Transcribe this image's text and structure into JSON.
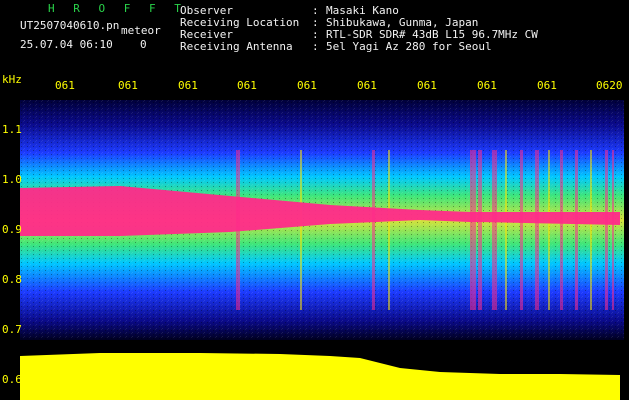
{
  "logo": {
    "text": "H R O F F T"
  },
  "file_info": {
    "filename": "UT2507040610.pn",
    "tag": "meteor",
    "datetime": "25.07.04 06:10",
    "count": "0"
  },
  "station": {
    "rows": [
      {
        "label": "Observer",
        "value": "Masaki Kano"
      },
      {
        "label": "Receiving Location",
        "value": "Shibukawa, Gunma, Japan"
      },
      {
        "label": "Receiver",
        "value": "RTL-SDR SDR# 43dB L15 96.7MHz CW"
      },
      {
        "label": "Receiving Antenna",
        "value": "5el Yagi Az 280 for Seoul"
      }
    ],
    "separator": ":"
  },
  "axis": {
    "unit": "kHz",
    "y_ticks": [
      "1.1",
      "1.0",
      "0.9",
      "0.8",
      "0.7",
      "0.6"
    ],
    "x_ticks": [
      "061",
      "061",
      "061",
      "061",
      "061",
      "061",
      "061",
      "061",
      "061",
      "0620"
    ]
  },
  "colors": {
    "background": "#000000",
    "label_yellow": "#ffff00",
    "header_white": "#f2f2f2",
    "logo_green": "#29d34a",
    "spectrum_dark": "#0a0a6e",
    "spectrum_blue": "#1a3cff",
    "spectrum_cyan": "#00d8ff",
    "spectrum_green": "#34e65a",
    "spectrum_yellow": "#ffe600",
    "signal_magenta": "#ff2a8a",
    "power_yellow": "#ffff00"
  }
}
